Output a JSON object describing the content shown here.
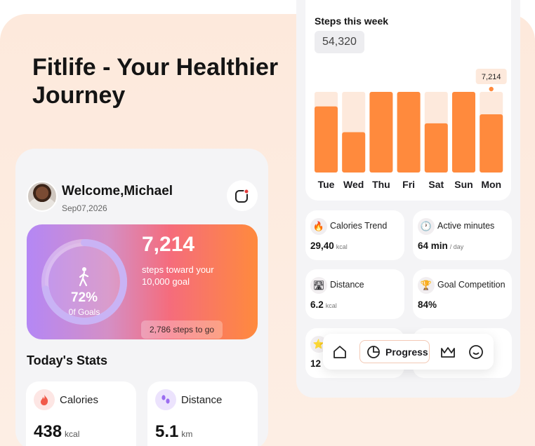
{
  "headline": "Fitlife - Your Healthier Journey",
  "left_screen": {
    "welcome": "Welcome,Michael",
    "date": "Sep07,2026",
    "goal": {
      "steps": "7,214",
      "description": "steps toward your 10,000 goal",
      "percent_text": "72%",
      "percent_value": 0.72,
      "percent_label": "0f Goals",
      "remaining": "2,786 steps to go"
    },
    "section_title": "Today's Stats",
    "stats": [
      {
        "label": "Calories",
        "value": "438",
        "unit": "kcal",
        "icon": "flame-icon",
        "color": "#f15a4a"
      },
      {
        "label": "Distance",
        "value": "5.1",
        "unit": "km",
        "icon": "footprints-icon",
        "color": "#9b6cf0"
      }
    ]
  },
  "right_screen": {
    "chart_title": "Steps this week",
    "chart_total": "54,320",
    "metrics": [
      {
        "label": "Calories Trend",
        "value": "29,40",
        "unit": "kcal",
        "icon": "flame-icon"
      },
      {
        "label": "Active minutes",
        "value": "64 min",
        "unit": "/ day",
        "icon": "clock-icon"
      },
      {
        "label": "Distance",
        "value": "6.2",
        "unit": "kcal",
        "icon": "road-icon"
      },
      {
        "label": "Goal Competition",
        "value": "84%",
        "unit": "",
        "icon": "trophy-icon"
      },
      {
        "label": "",
        "value": "12",
        "unit": "",
        "icon": "star-icon"
      }
    ]
  },
  "navbar": {
    "active_label": "Progress",
    "items": [
      "home-icon",
      "progress-icon",
      "crown-icon",
      "smile-icon"
    ]
  },
  "colors": {
    "accent": "#ff8a3d",
    "bar_track": "#fde9dc",
    "background": "#fde9dc"
  },
  "chart_data": {
    "type": "bar",
    "title": "Steps this week",
    "categories": [
      "Tue",
      "Wed",
      "Thu",
      "Fri",
      "Sat",
      "Sun",
      "Mon"
    ],
    "values": [
      8200,
      5000,
      10000,
      10000,
      6100,
      10000,
      7214
    ],
    "ylim": [
      0,
      10000
    ],
    "highlight": {
      "category": "Mon",
      "label": "7,214"
    },
    "grid": false
  }
}
